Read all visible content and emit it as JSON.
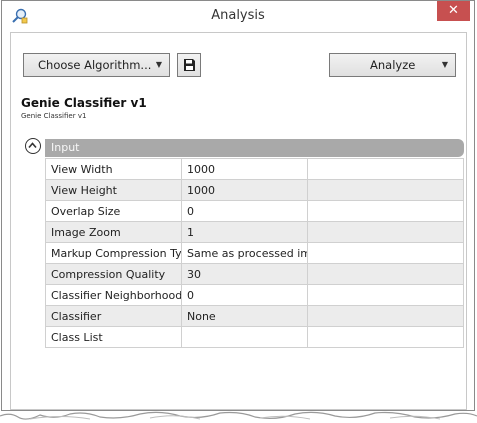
{
  "window": {
    "title": "Analysis",
    "close_glyph": "✕"
  },
  "toolbar": {
    "choose_label": "Choose Algorithm...",
    "analyze_label": "Analyze",
    "dropdown_glyph": "▼"
  },
  "classifier": {
    "title": "Genie Classifier v1",
    "subtitle": "Genie Classifier v1"
  },
  "section": {
    "label": "Input"
  },
  "properties": [
    {
      "name": "View Width",
      "value": "1000"
    },
    {
      "name": "View Height",
      "value": "1000"
    },
    {
      "name": "Overlap Size",
      "value": "0"
    },
    {
      "name": "Image Zoom",
      "value": "1"
    },
    {
      "name": "Markup Compression Type",
      "value": "Same as processed image"
    },
    {
      "name": "Compression Quality",
      "value": "30"
    },
    {
      "name": "Classifier Neighborhood",
      "value": "0"
    },
    {
      "name": "Classifier",
      "value": "None"
    },
    {
      "name": "Class List",
      "value": ""
    }
  ],
  "colors": {
    "close_button": "#c75050",
    "section_bar": "#a9a9a9",
    "alt_row": "#ececec"
  }
}
